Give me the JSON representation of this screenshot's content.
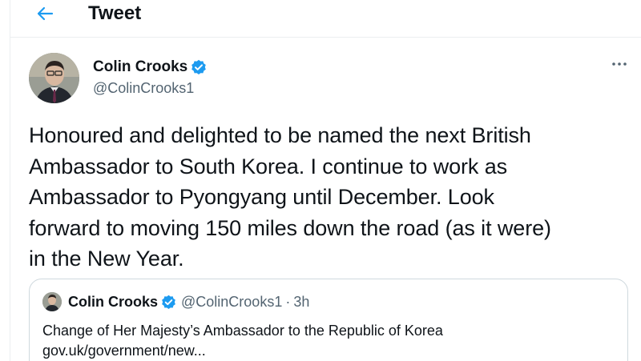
{
  "header": {
    "title": "Tweet",
    "back_icon": "back-arrow-icon"
  },
  "colors": {
    "accent": "#1d9bf0",
    "text": "#0f1419",
    "secondary_text": "#536471",
    "border": "#cfd9de"
  },
  "tweet": {
    "author_name": "Colin Crooks",
    "author_handle": "@ColinCrooks1",
    "verified": true,
    "more_icon": "more-options-icon",
    "text_lines": [
      "Honoured and delighted to be named the next British",
      "Ambassador to South Korea. I continue to work as",
      "Ambassador to Pyongyang until December. Look",
      "forward to moving 150 miles down the road (as it were)",
      "in the New Year."
    ]
  },
  "quoted_tweet": {
    "author_name": "Colin Crooks",
    "author_handle": "@ColinCrooks1",
    "separator": "·",
    "time": "3h",
    "verified": true,
    "text": "Change of Her Majesty’s Ambassador to the Republic of Korea",
    "link": "gov.uk/government/new..."
  }
}
